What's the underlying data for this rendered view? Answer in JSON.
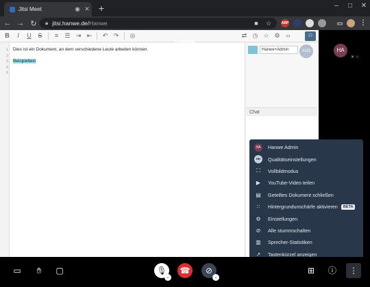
{
  "browser": {
    "tab_title": "Jitsi Meet",
    "new_tab_label": "+",
    "url_host": "jitsi.hanwe.de/",
    "url_path": "Hanwe",
    "ext_adblock": "ABP"
  },
  "meeting": {
    "room_name": "Hanwe",
    "audience_badge": "AUD",
    "participant_initials": "HA"
  },
  "pad": {
    "line_numbers": [
      "1",
      "2",
      "3",
      "4",
      "5"
    ],
    "lines": [
      "Dies ist ein Dokument, an dem verschiedene Leute arbeiten können.",
      "",
      "Beispieltext",
      "",
      ""
    ],
    "user_name": "Hanwe+Admin",
    "chat_title": "Chat"
  },
  "menu": {
    "items": [
      {
        "label": "Hanwe Admin",
        "icon": "avatar-icon",
        "avatar": "HA"
      },
      {
        "label": "Qualitätseinstellungen",
        "icon": "hd-icon",
        "badge": "HD"
      },
      {
        "label": "Vollbildmodus",
        "icon": "fullscreen-icon"
      },
      {
        "label": "YouTube-Video teilen",
        "icon": "play-icon"
      },
      {
        "label": "Geteiltes Dokument schließen",
        "icon": "document-icon"
      },
      {
        "label": "Hintergrundunschärfe aktivieren",
        "icon": "blur-icon",
        "tag": "BETA"
      },
      {
        "label": "Einstellungen",
        "icon": "gear-icon"
      },
      {
        "label": "Alle stummschalten",
        "icon": "mute-all-icon"
      },
      {
        "label": "Sprecher-Statistiken",
        "icon": "stats-icon"
      },
      {
        "label": "Tastenkürzel anzeigen",
        "icon": "shortcut-icon"
      }
    ]
  },
  "colors": {
    "menu_bg": "#28374a",
    "hangup": "#dd2f2f",
    "highlight": "#9be0ea",
    "avatar": "#7a3b55"
  }
}
